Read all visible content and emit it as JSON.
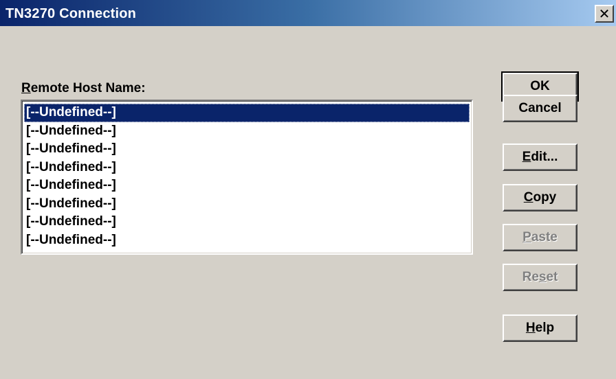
{
  "window": {
    "title": "TN3270 Connection"
  },
  "host_list": {
    "label_mnemonic": "R",
    "label_rest": "emote Host Name:",
    "items": [
      "[--Undefined--]",
      "[--Undefined--]",
      "[--Undefined--]",
      "[--Undefined--]",
      "[--Undefined--]",
      "[--Undefined--]",
      "[--Undefined--]",
      "[--Undefined--]"
    ],
    "selected_index": 0
  },
  "buttons": {
    "ok": "OK",
    "cancel": "Cancel",
    "edit": {
      "mnemonic": "E",
      "rest": "dit..."
    },
    "copy": {
      "mnemonic": "C",
      "rest": "opy"
    },
    "paste": {
      "mnemonic": "P",
      "rest": "aste",
      "enabled": false
    },
    "reset": {
      "before": "Re",
      "mnemonic": "s",
      "after": "et",
      "enabled": false
    },
    "help": {
      "mnemonic": "H",
      "rest": "elp"
    }
  },
  "colors": {
    "selection": "#0a246a",
    "dialog_face": "#d4d0c8",
    "disabled_text": "#808080"
  }
}
